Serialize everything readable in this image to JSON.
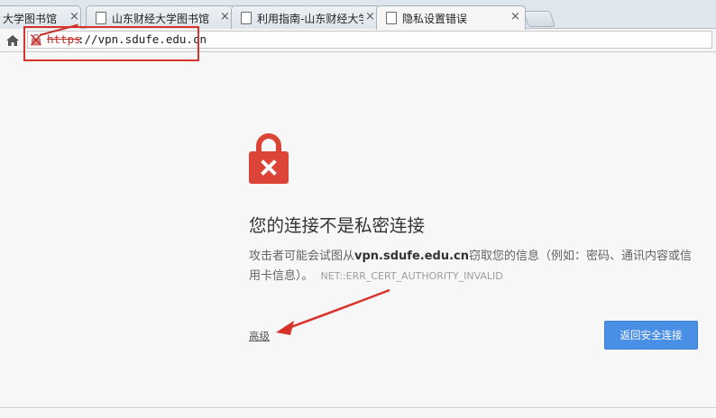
{
  "tabs": [
    {
      "title": "大学图书馆",
      "active": false
    },
    {
      "title": "山东财经大学图书馆",
      "active": false
    },
    {
      "title": "利用指南-山东财经大学",
      "active": false
    },
    {
      "title": "隐私设置错误",
      "active": true
    }
  ],
  "tab_close_glyph": "×",
  "address_bar": {
    "scheme": "https",
    "rest": "://vpn.sdufe.edu.cn"
  },
  "icons": {
    "home": "home-icon",
    "security": "lock-x-icon",
    "page": "page-icon",
    "big_lock": "broken-lock-icon"
  },
  "interstitial": {
    "heading": "您的连接不是私密连接",
    "desc_before": "攻击者可能会试图从",
    "desc_host": "vpn.sdufe.edu.cn",
    "desc_after": "窃取您的信息（例如：密码、通讯内容或信用卡信息）。",
    "error_code": "NET::ERR_CERT_AUTHORITY_INVALID",
    "advanced_label": "高级",
    "back_button_label": "返回安全连接"
  },
  "colors": {
    "lock_red": "#db4437",
    "annotation_red": "#d8332b",
    "button_blue": "#4a8fe6"
  }
}
